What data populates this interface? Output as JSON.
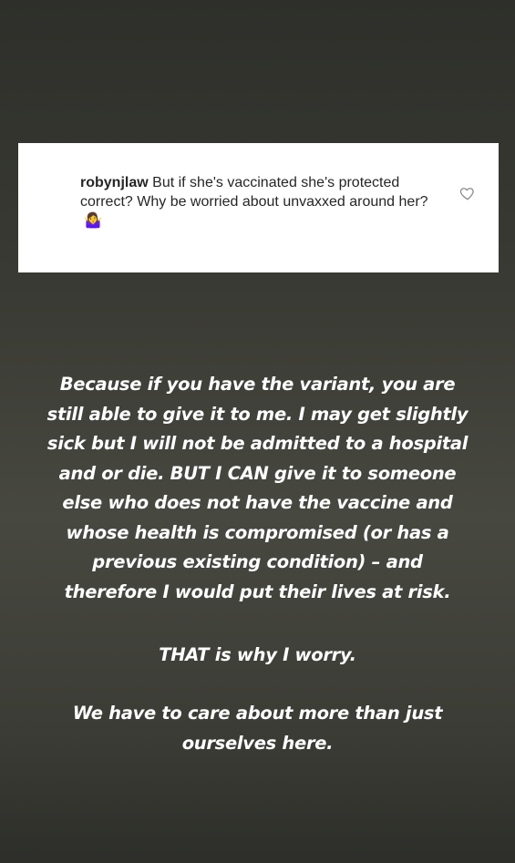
{
  "comment": {
    "username": "robynjlaw",
    "text": "But if she's vaccinated she's protected correct? Why be worried about unvaxxed around her?",
    "emoji": "🤷‍♀️",
    "like_icon": "heart-outline-icon"
  },
  "story": {
    "paragraph1_lines": [
      "Because if you have the variant, you are",
      "still able to give it to me. I may get slightly",
      "sick but I will not be admitted to a hospital",
      "and or die. BUT I CAN give it to someone",
      "else who does not have the vaccine and",
      "whose health is compromised (or has a",
      "previous existing condition) – and",
      "therefore I would put their lives at risk."
    ],
    "paragraph2": "THAT is why I worry.",
    "paragraph3_lines": [
      "We have to care about more than just",
      "ourselves here."
    ]
  },
  "colors": {
    "text": "#ffffff",
    "card_bg": "#ffffff",
    "comment_text": "#262626"
  }
}
